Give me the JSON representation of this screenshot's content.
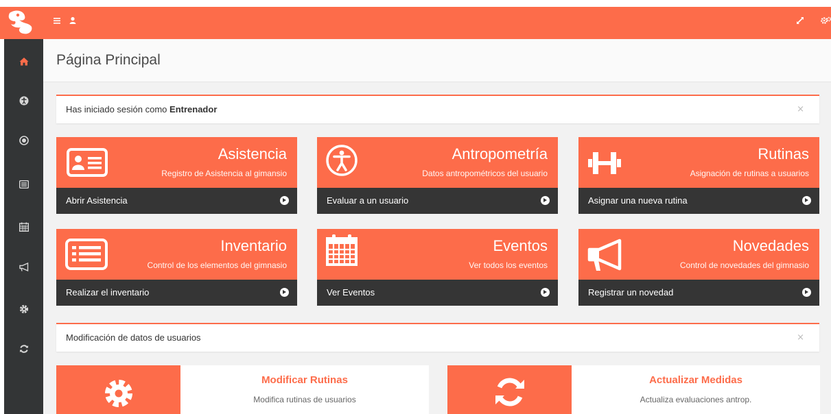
{
  "colors": {
    "accent": "#fd6c4a",
    "sidebar": "#333536",
    "dark": "#353535"
  },
  "topbar": {
    "menu_icon": "bars-icon",
    "user_icon": "user-icon",
    "expand_icon": "expand-icon",
    "settings_icon": "gears-icon"
  },
  "sidebar": {
    "items": [
      {
        "icon": "home-icon",
        "active": true
      },
      {
        "icon": "accessibility-icon"
      },
      {
        "icon": "dot-circle-icon"
      },
      {
        "icon": "list-alt-icon"
      },
      {
        "icon": "calendar-icon"
      },
      {
        "icon": "bullhorn-icon"
      },
      {
        "icon": "gear-icon"
      },
      {
        "icon": "refresh-icon"
      }
    ]
  },
  "page": {
    "title": "Página Principal"
  },
  "session": {
    "prefix": "Has iniciado sesión como ",
    "role": "Entrenador",
    "close": "×"
  },
  "cards": [
    {
      "title": "Asistencia",
      "subtitle": "Registro de Asistencia al gimansio",
      "action": "Abrir Asistencia",
      "icon": "id-card-icon"
    },
    {
      "title": "Antropometría",
      "subtitle": "Datos antropométricos del usuario",
      "action": "Evaluar a un usuario",
      "icon": "accessibility-icon"
    },
    {
      "title": "Rutinas",
      "subtitle": "Asignación de rutinas a usuarios",
      "action": "Asignar una nueva rutina",
      "icon": "dumbbell-icon"
    },
    {
      "title": "Inventario",
      "subtitle": "Control de los elementos del gimnasio",
      "action": "Realizar el inventario",
      "icon": "list-alt-icon"
    },
    {
      "title": "Eventos",
      "subtitle": "Ver todos los eventos",
      "action": "Ver Eventos",
      "icon": "calendar-icon"
    },
    {
      "title": "Novedades",
      "subtitle": "Control de novedades del gimnasio",
      "action": "Registrar un novedad",
      "icon": "bullhorn-icon"
    }
  ],
  "modify_panel": {
    "text": "Modificación de datos de usuarios",
    "close": "×"
  },
  "boxes": [
    {
      "title": "Modificar Rutinas",
      "subtitle": "Modifica rutinas de usuarios",
      "icon": "gear-icon"
    },
    {
      "title": "Actualizar Medidas",
      "subtitle": "Actualiza evaluaciones antrop.",
      "icon": "refresh-icon"
    }
  ]
}
